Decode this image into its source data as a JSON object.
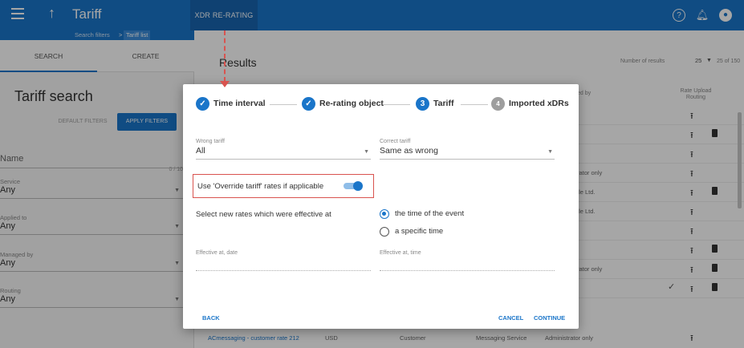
{
  "topbar": {
    "title": "Tariff",
    "active_tab": "XDR RE-RATING",
    "icons": [
      "menu-icon",
      "arrow-up-icon",
      "help-icon",
      "bell-icon",
      "user-icon"
    ]
  },
  "breadcrumb": {
    "items": [
      "Search filters",
      "Tariff list"
    ],
    "separator": ">"
  },
  "left": {
    "tabs": [
      "SEARCH",
      "CREATE"
    ],
    "title": "Tariff search",
    "default_filters": "DEFAULT FILTERS",
    "apply_filters": "APPLY FILTERS",
    "name": {
      "label": "Name",
      "counter": "0 / 10"
    },
    "service": {
      "label": "Service",
      "value": "Any"
    },
    "applied_to": {
      "label": "Applied to",
      "value": "Any"
    },
    "managed_by": {
      "label": "Managed by",
      "value": "Any"
    },
    "routing": {
      "label": "Routing",
      "value": "Any"
    }
  },
  "results": {
    "title": "Results",
    "number_of_results_label": "Number of results",
    "page_size": "25",
    "range": "25 of 150",
    "col_managed_by": "ed by",
    "col_routing": "Routing",
    "col_rate_upload": "Rate Upload",
    "rows": [
      {
        "text": ""
      },
      {
        "text": ""
      },
      {
        "text": ""
      },
      {
        "text": "rator only"
      },
      {
        "text": "tle Ltd."
      },
      {
        "text": "tle Ltd."
      },
      {
        "text": ""
      },
      {
        "text": ""
      },
      {
        "text": "rator only"
      },
      {
        "text": ""
      }
    ],
    "last_row": {
      "name": "ACmessaging - customer rate 212",
      "currency": "USD",
      "applied_to": "Customer",
      "service": "Messaging Service",
      "managed_by": "Administrator only"
    }
  },
  "dialog": {
    "steps": [
      {
        "label": "Time interval",
        "state": "done"
      },
      {
        "label": "Re-rating object",
        "state": "done"
      },
      {
        "number": "3",
        "label": "Tariff",
        "state": "active"
      },
      {
        "number": "4",
        "label": "Imported xDRs",
        "state": "pending"
      }
    ],
    "wrong_tariff": {
      "label": "Wrong tariff",
      "value": "All"
    },
    "correct_tariff": {
      "label": "Correct tariff",
      "value": "Same as wrong"
    },
    "override_label": "Use 'Override tariff' rates if applicable",
    "override_enabled": true,
    "select_rates_label": "Select new rates which were effective at",
    "radio_options": [
      "the time of the event",
      "a specific time"
    ],
    "radio_selected": "the time of the event",
    "effective_date": {
      "label": "Effective at, date",
      "value": ""
    },
    "effective_time": {
      "label": "Effective at, time",
      "value": ""
    },
    "back": "BACK",
    "cancel": "CANCEL",
    "continue": "CONTINUE"
  },
  "colors": {
    "primary": "#1a75c9",
    "annotation": "#d9534f"
  }
}
